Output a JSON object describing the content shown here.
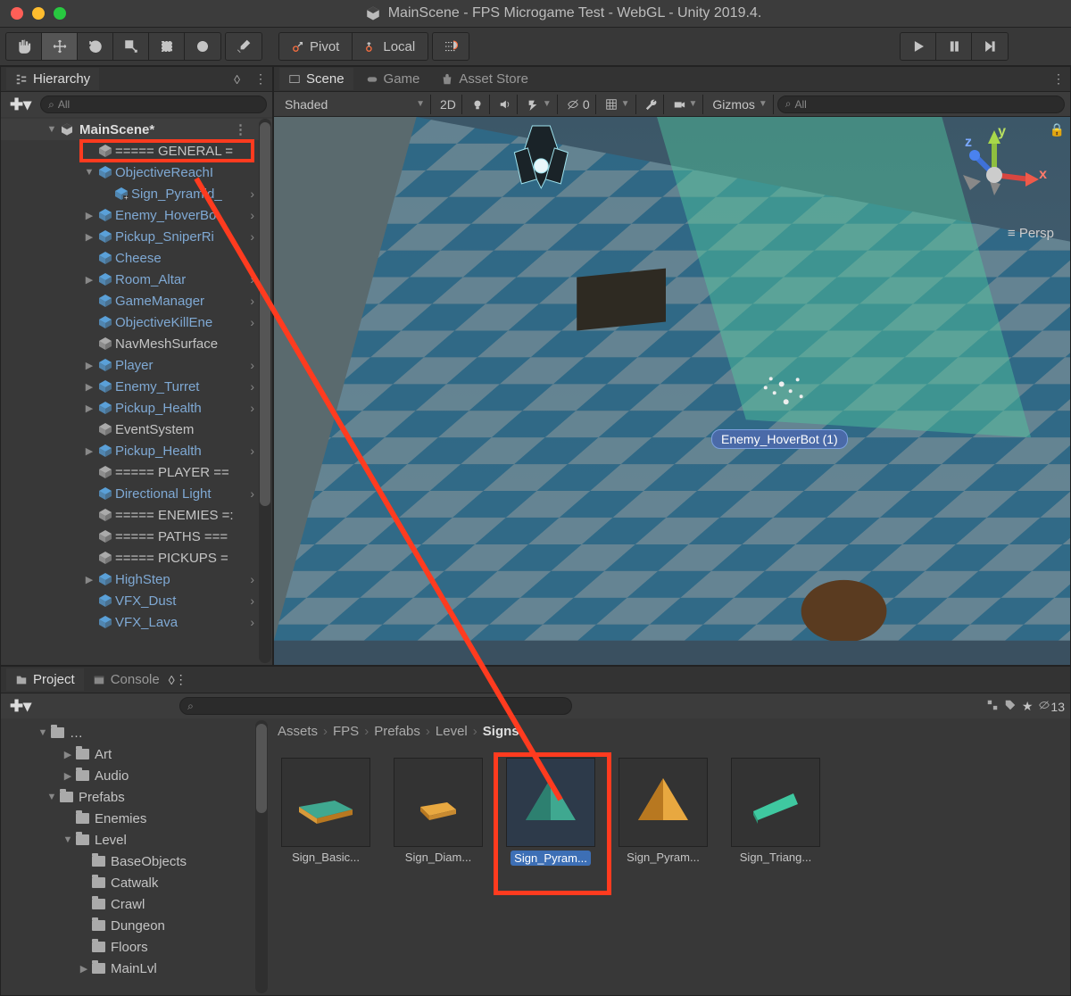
{
  "window": {
    "title": "MainScene - FPS Microgame Test - WebGL - Unity 2019.4."
  },
  "toolbar": {
    "pivot": "Pivot",
    "local": "Local"
  },
  "hierarchy": {
    "title": "Hierarchy",
    "search_placeholder": "All",
    "scene": "MainScene*",
    "items": [
      {
        "t": "===== GENERAL =",
        "p": false,
        "f": null,
        "i": 1
      },
      {
        "t": "ObjectiveReachI",
        "p": true,
        "f": "open",
        "i": 1,
        "sel": true
      },
      {
        "t": "Sign_Pyramid_",
        "p": true,
        "f": null,
        "i": 2,
        "cv": true,
        "plus": true
      },
      {
        "t": "Enemy_HoverBo",
        "p": true,
        "f": "closed",
        "i": 1,
        "cv": true
      },
      {
        "t": "Pickup_SniperRi",
        "p": true,
        "f": "closed",
        "i": 1,
        "cv": true
      },
      {
        "t": "Cheese",
        "p": true,
        "f": null,
        "i": 1
      },
      {
        "t": "Room_Altar",
        "p": true,
        "f": "closed",
        "i": 1,
        "cv": true
      },
      {
        "t": "GameManager",
        "p": true,
        "f": null,
        "i": 1,
        "cv": true
      },
      {
        "t": "ObjectiveKillEne",
        "p": true,
        "f": null,
        "i": 1,
        "cv": true
      },
      {
        "t": "NavMeshSurface",
        "p": false,
        "f": null,
        "i": 1
      },
      {
        "t": "Player",
        "p": true,
        "f": "closed",
        "i": 1,
        "cv": true
      },
      {
        "t": "Enemy_Turret",
        "p": true,
        "f": "closed",
        "i": 1,
        "cv": true
      },
      {
        "t": "Pickup_Health",
        "p": true,
        "f": "closed",
        "i": 1,
        "cv": true
      },
      {
        "t": "EventSystem",
        "p": false,
        "f": null,
        "i": 1
      },
      {
        "t": "Pickup_Health",
        "p": true,
        "f": "closed",
        "i": 1,
        "cv": true
      },
      {
        "t": "===== PLAYER ==",
        "p": false,
        "f": null,
        "i": 1
      },
      {
        "t": "Directional Light",
        "p": true,
        "f": null,
        "i": 1,
        "cv": true
      },
      {
        "t": "===== ENEMIES =:",
        "p": false,
        "f": null,
        "i": 1
      },
      {
        "t": "===== PATHS ===",
        "p": false,
        "f": null,
        "i": 1
      },
      {
        "t": "===== PICKUPS =",
        "p": false,
        "f": null,
        "i": 1
      },
      {
        "t": "HighStep",
        "p": true,
        "f": "closed",
        "i": 1,
        "cv": true
      },
      {
        "t": "VFX_Dust",
        "p": true,
        "f": null,
        "i": 1,
        "cv": true
      },
      {
        "t": "VFX_Lava",
        "p": true,
        "f": null,
        "i": 1,
        "cv": true
      }
    ]
  },
  "scene": {
    "tab_scene": "Scene",
    "tab_game": "Game",
    "tab_store": "Asset Store",
    "shaded": "Shaded",
    "twod": "2D",
    "gizmos": "Gizmos",
    "search": "All",
    "vis": "0",
    "persp": "Persp",
    "axis_x": "x",
    "axis_y": "y",
    "axis_z": "z",
    "hoverbot": "Enemy_HoverBot (1)"
  },
  "project": {
    "tab_project": "Project",
    "tab_console": "Console",
    "hidden": "13",
    "tree": [
      {
        "t": "Art",
        "f": "closed",
        "i": 1
      },
      {
        "t": "Audio",
        "f": "closed",
        "i": 1
      },
      {
        "t": "Prefabs",
        "f": "open",
        "i": 0
      },
      {
        "t": "Enemies",
        "f": null,
        "i": 1
      },
      {
        "t": "Level",
        "f": "open",
        "i": 1
      },
      {
        "t": "BaseObjects",
        "f": null,
        "i": 2
      },
      {
        "t": "Catwalk",
        "f": null,
        "i": 2
      },
      {
        "t": "Crawl",
        "f": null,
        "i": 2
      },
      {
        "t": "Dungeon",
        "f": null,
        "i": 2
      },
      {
        "t": "Floors",
        "f": null,
        "i": 2
      },
      {
        "t": "MainLvl",
        "f": "closed",
        "i": 2
      }
    ],
    "breadcrumb": [
      "Assets",
      "FPS",
      "Prefabs",
      "Level",
      "Signs"
    ],
    "assets": [
      {
        "l": "Sign_Basic...",
        "shape": "box-teal",
        "sel": false
      },
      {
        "l": "Sign_Diam...",
        "shape": "box-orange",
        "sel": false
      },
      {
        "l": "Sign_Pyram...",
        "shape": "pyramid-teal",
        "sel": true
      },
      {
        "l": "Sign_Pyram...",
        "shape": "pyramid-orange",
        "sel": false
      },
      {
        "l": "Sign_Triang...",
        "shape": "triangle-teal",
        "sel": false
      }
    ]
  }
}
